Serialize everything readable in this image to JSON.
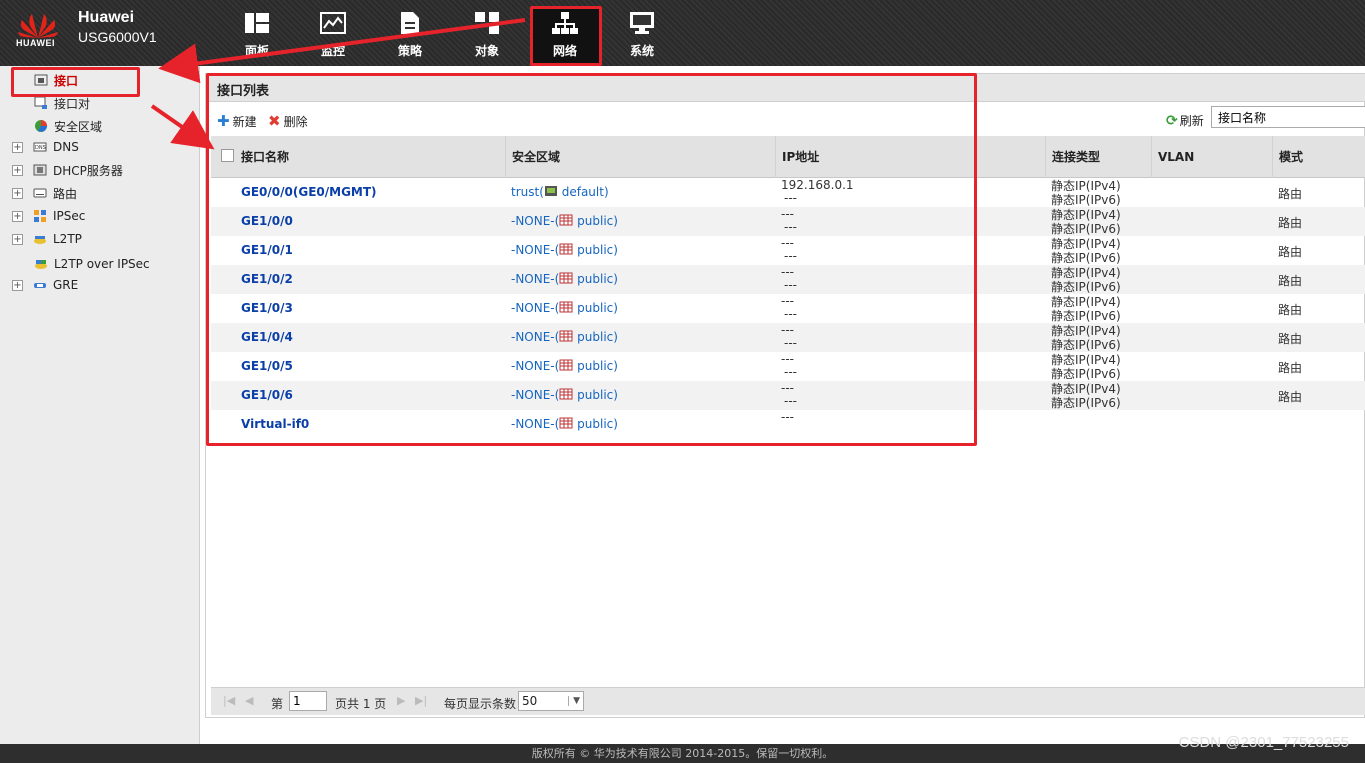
{
  "brand": {
    "logo_text": "HUAWEI",
    "name": "Huawei",
    "model": "USG6000V1"
  },
  "nav": [
    {
      "label": "面板",
      "icon": "dashboard-icon"
    },
    {
      "label": "监控",
      "icon": "monitor-icon"
    },
    {
      "label": "策略",
      "icon": "policy-icon"
    },
    {
      "label": "对象",
      "icon": "object-icon"
    },
    {
      "label": "网络",
      "icon": "network-icon",
      "active": true
    },
    {
      "label": "系统",
      "icon": "system-icon"
    }
  ],
  "sidebar": {
    "items": [
      {
        "label": "接口",
        "icon": "interface-icon",
        "selected": true
      },
      {
        "label": "接口对",
        "icon": "interface-pair-icon"
      },
      {
        "label": "安全区域",
        "icon": "security-zone-icon"
      },
      {
        "label": "DNS",
        "icon": "dns-icon",
        "expandable": true
      },
      {
        "label": "DHCP服务器",
        "icon": "dhcp-icon",
        "expandable": true
      },
      {
        "label": "路由",
        "icon": "route-icon",
        "expandable": true
      },
      {
        "label": "IPSec",
        "icon": "ipsec-icon",
        "expandable": true
      },
      {
        "label": "L2TP",
        "icon": "l2tp-icon",
        "expandable": true
      },
      {
        "label": "L2TP over IPSec",
        "icon": "l2tp-ipsec-icon"
      },
      {
        "label": "GRE",
        "icon": "gre-icon",
        "expandable": true
      }
    ]
  },
  "main": {
    "title": "接口列表",
    "toolbar": {
      "new_label": "新建",
      "delete_label": "删除",
      "refresh_label": "刷新",
      "search_value": "接口名称"
    },
    "columns": [
      "接口名称",
      "安全区域",
      "IP地址",
      "连接类型",
      "VLAN",
      "模式"
    ],
    "rows": [
      {
        "name": "GE0/0/0(GE0/MGMT)",
        "zone_prefix": "trust(",
        "zone_vsys": "default)",
        "ip1": "192.168.0.1",
        "ip2": "---",
        "conn1": "静态IP(IPv4)",
        "conn2": "静态IP(IPv6)",
        "mode": "路由"
      },
      {
        "name": "GE1/0/0",
        "zone_prefix": "-NONE-(",
        "zone_vsys": "public)",
        "ip1": "---",
        "ip2": "---",
        "conn1": "静态IP(IPv4)",
        "conn2": "静态IP(IPv6)",
        "mode": "路由"
      },
      {
        "name": "GE1/0/1",
        "zone_prefix": "-NONE-(",
        "zone_vsys": "public)",
        "ip1": "---",
        "ip2": "---",
        "conn1": "静态IP(IPv4)",
        "conn2": "静态IP(IPv6)",
        "mode": "路由"
      },
      {
        "name": "GE1/0/2",
        "zone_prefix": "-NONE-(",
        "zone_vsys": "public)",
        "ip1": "---",
        "ip2": "---",
        "conn1": "静态IP(IPv4)",
        "conn2": "静态IP(IPv6)",
        "mode": "路由"
      },
      {
        "name": "GE1/0/3",
        "zone_prefix": "-NONE-(",
        "zone_vsys": "public)",
        "ip1": "---",
        "ip2": "---",
        "conn1": "静态IP(IPv4)",
        "conn2": "静态IP(IPv6)",
        "mode": "路由"
      },
      {
        "name": "GE1/0/4",
        "zone_prefix": "-NONE-(",
        "zone_vsys": "public)",
        "ip1": "---",
        "ip2": "---",
        "conn1": "静态IP(IPv4)",
        "conn2": "静态IP(IPv6)",
        "mode": "路由"
      },
      {
        "name": "GE1/0/5",
        "zone_prefix": "-NONE-(",
        "zone_vsys": "public)",
        "ip1": "---",
        "ip2": "---",
        "conn1": "静态IP(IPv4)",
        "conn2": "静态IP(IPv6)",
        "mode": "路由"
      },
      {
        "name": "GE1/0/6",
        "zone_prefix": "-NONE-(",
        "zone_vsys": "public)",
        "ip1": "---",
        "ip2": "---",
        "conn1": "静态IP(IPv4)",
        "conn2": "静态IP(IPv6)",
        "mode": "路由"
      },
      {
        "name": "Virtual-if0",
        "zone_prefix": "-NONE-(",
        "zone_vsys": "public)",
        "ip1": "---",
        "ip2": "",
        "conn1": "",
        "conn2": "",
        "mode": ""
      }
    ],
    "pager": {
      "page_label": "第",
      "page_value": "1",
      "total_label": "页共 1 页",
      "per_page_label": "每页显示条数",
      "per_page_value": "50"
    }
  },
  "footer": {
    "copyright": "版权所有 © 华为技术有限公司 2014-2015。保留一切权利。"
  },
  "watermark": "CSDN @2301_77523255",
  "colors": {
    "annotation_red": "#e6232a",
    "link_blue": "#1565c0",
    "header_bg": "#2e2e2e"
  }
}
